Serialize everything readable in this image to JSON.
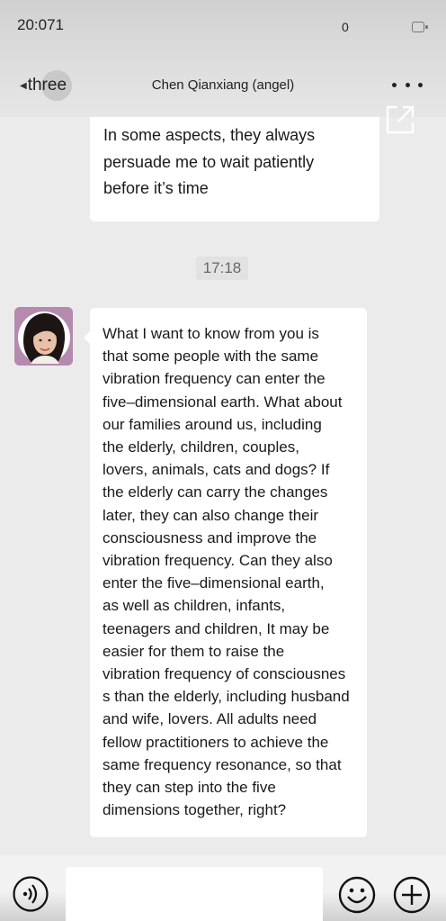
{
  "status_bar": {
    "time": "20:071",
    "indicator": "0",
    "battery_icon": "battery-icon"
  },
  "header": {
    "back_label": "three",
    "title": "Chen Qianxiang (angel)",
    "more_icon": "more-dots-icon",
    "share_icon": "open-external-icon"
  },
  "messages": [
    {
      "lines": [
        "In some aspects, they always",
        "persuade me to wait patiently",
        "before it’s time"
      ]
    },
    {
      "timestamp": "17:18"
    },
    {
      "lines": [
        "What I want to know from you is",
        "that some people with the same",
        "vibration frequency can enter the",
        "five–dimensional earth. What about",
        "our families around us, including",
        "the elderly, children, couples,",
        "lovers, animals, cats and dogs? If",
        "the elderly can carry the changes",
        "later, they can also change their",
        "consciousness and improve the",
        "vibration frequency. Can they also",
        "enter the five–dimensional earth,",
        "as well as children, infants,",
        "teenagers and children, It may be",
        "easier for them to raise the",
        "vibration frequency of consciousnes",
        "s than the elderly, including husband",
        "and wife, lovers. All adults need",
        "fellow practitioners to achieve the",
        "same frequency resonance, so that",
        "they can step into the five",
        "dimensions together, right?"
      ]
    }
  ],
  "input_bar": {
    "voice_icon": "voice-icon",
    "input_value": "",
    "emoji_icon": "emoji-icon",
    "plus_icon": "plus-icon"
  }
}
